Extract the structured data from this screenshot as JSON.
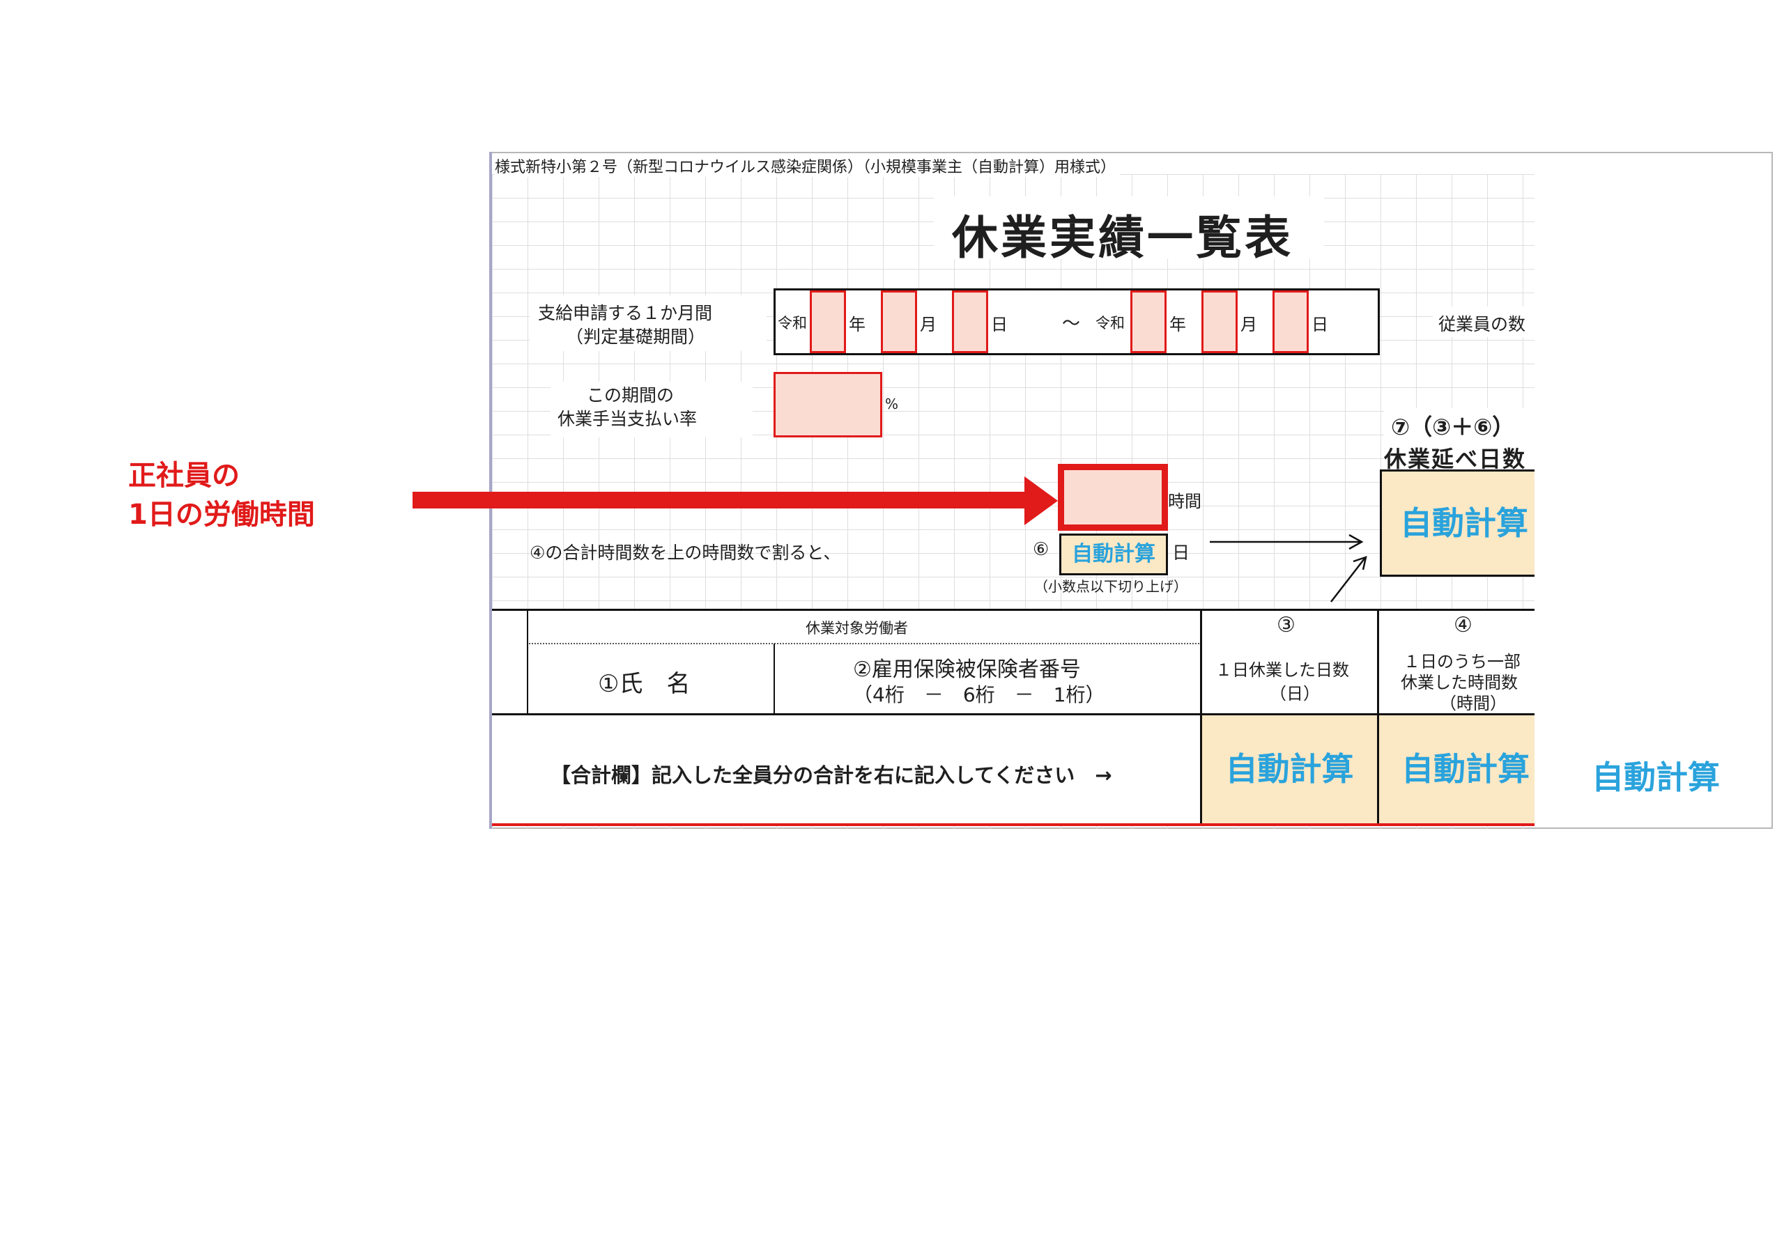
{
  "form": {
    "header": "様式新特小第２号（新型コロナウイルス感染症関係）（小規模事業主（自動計算）用様式）",
    "title": "休業実績一覧表"
  },
  "period": {
    "label_line1": "支給申請する１か月間",
    "label_line2": "（判定基礎期間）",
    "reiwa": "令和",
    "year": "年",
    "month": "月",
    "day": "日",
    "tilde": "～",
    "employees_label": "従業員の数"
  },
  "rate": {
    "label_line1": "この期間の",
    "label_line2": "休業手当支払い率",
    "unit": "%"
  },
  "hours": {
    "unit": "時間",
    "divide_text": "④の合計時間数を上の時間数で割ると、",
    "circle6": "⑥",
    "day_unit": "日",
    "round_note": "（小数点以下切り上げ）"
  },
  "seven": {
    "header_line1": "⑦（③＋⑥）",
    "header_line2": "休業延べ日数"
  },
  "auto_calc": "自動計算",
  "annotation": {
    "line1": "正社員の",
    "line2": "1日の労働時間"
  },
  "table": {
    "group_header": "休業対象労働者",
    "col1": "①氏　名",
    "col2_line1": "②雇用保険被保険者番号",
    "col2_line2": "（4桁　－　6桁　－　1桁）",
    "col3_num": "③",
    "col3_line1": "１日休業した日数",
    "col3_line2": "（日）",
    "col4_num": "④",
    "col4_line1": "１日のうち一部",
    "col4_line2": "休業した時間数",
    "col4_line3": "（時間）",
    "total_label": "【合計欄】記入した全員分の合計を右に記入してください　→"
  },
  "colors": {
    "red": "#e11a1a",
    "pink_fill": "#fbdcd3",
    "cream_fill": "#fbe8c5",
    "auto_text": "#2aa3dc"
  }
}
